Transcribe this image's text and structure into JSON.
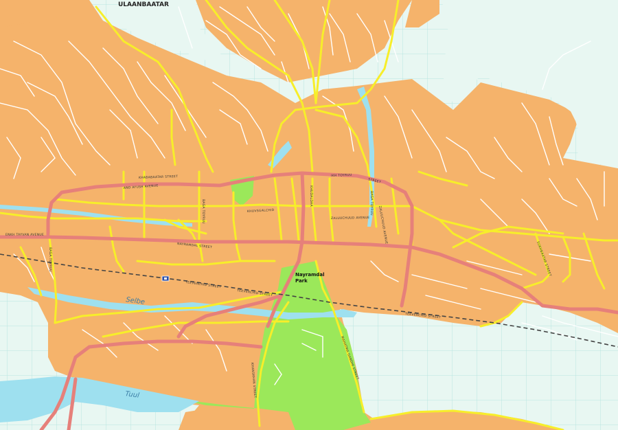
{
  "map": {
    "city_label": "ULAANBAATAR",
    "park_label_line1": "Nayramdal",
    "park_label_line2": "Park",
    "river_labels": [
      "Selbe",
      "Tuul"
    ],
    "street_labels": [
      "AND AYUSH AVENUE",
      "KHABABAATAR STREET",
      "ENKH TAYVAN AVENUE",
      "KHUVSGALCHID",
      "NAYRAMDAL STREET",
      "TEEVERCHID STREET",
      "TEEVERCHID STREET",
      "TEEVERCHID STREET",
      "ZALUUCHUUD AVENUE",
      "IKH TOYRUU",
      "STREET",
      "KHUDALDAA",
      "BAGA TOYRUU",
      "BAGA TOYRUU",
      "BAGA TOYRUU",
      "SUKHBAATAR STREET",
      "MAHATMA GANDHI STREET",
      "KHANSKHAN STREET",
      "ZALUUCHUUD AVENUE"
    ],
    "colors": {
      "background": "#e8f7f2",
      "grid": "#b8e4e0",
      "urban": "#f5b36b",
      "park": "#9be85a",
      "water": "#9ee0ef",
      "major_road": "#e6807a",
      "secondary_road": "#f7ee2a",
      "minor_road": "#ffffff",
      "railway": "#444444"
    },
    "icons": [
      "railway-station-icon"
    ]
  }
}
